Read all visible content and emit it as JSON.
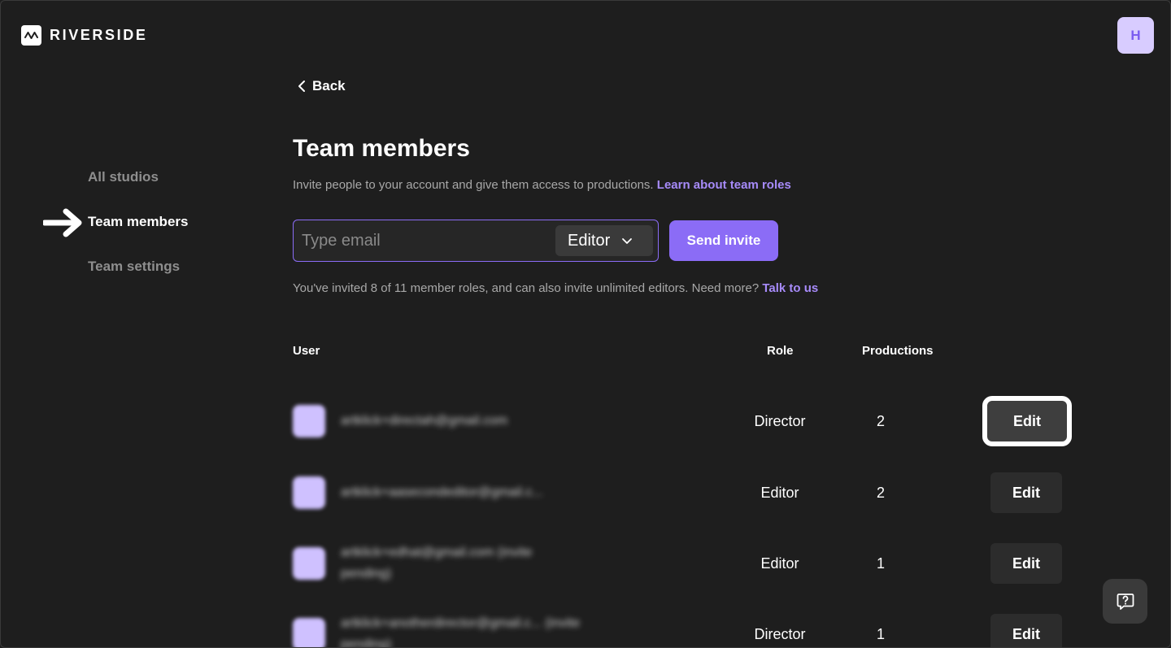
{
  "brand": {
    "name": "RIVERSIDE"
  },
  "user": {
    "initial": "H"
  },
  "sidebar": {
    "items": [
      {
        "label": "All studios",
        "active": false
      },
      {
        "label": "Team members",
        "active": true
      },
      {
        "label": "Team settings",
        "active": false
      }
    ]
  },
  "header": {
    "back_label": "Back",
    "title": "Team members",
    "subtitle": "Invite people to your account and give them access to productions.",
    "subtitle_link": "Learn about team roles"
  },
  "invite": {
    "email_placeholder": "Type email",
    "email_value": "",
    "role_selected": "Editor",
    "send_label": "Send invite"
  },
  "limit": {
    "text": "You've invited 8 of 11 member roles, and can also invite unlimited editors. Need more?",
    "link": "Talk to us"
  },
  "table": {
    "columns": {
      "user": "User",
      "role": "Role",
      "productions": "Productions"
    },
    "rows": [
      {
        "email": "artklick+directah@gmail.com",
        "role": "Director",
        "productions": "2",
        "edit_label": "Edit"
      },
      {
        "email": "artklick+aasecondeditor@gmail.c...",
        "role": "Editor",
        "productions": "2",
        "edit_label": "Edit"
      },
      {
        "email": "artklick+edhat@gmail.com (invite pending)",
        "role": "Editor",
        "productions": "1",
        "edit_label": "Edit"
      },
      {
        "email": "artklick+anotherdirector@gmail.c... (invite pending)",
        "role": "Director",
        "productions": "1",
        "edit_label": "Edit"
      }
    ]
  },
  "colors": {
    "background": "#1e1e1e",
    "accent": "#8b6cf6",
    "link": "#a78bfa",
    "muted_text": "#a8a8a8"
  },
  "icons": {
    "logo": "waveform-icon",
    "back": "chevron-left-icon",
    "dropdown": "chevron-down-icon",
    "pointer": "arrow-right-icon",
    "help": "help-chat-icon"
  }
}
